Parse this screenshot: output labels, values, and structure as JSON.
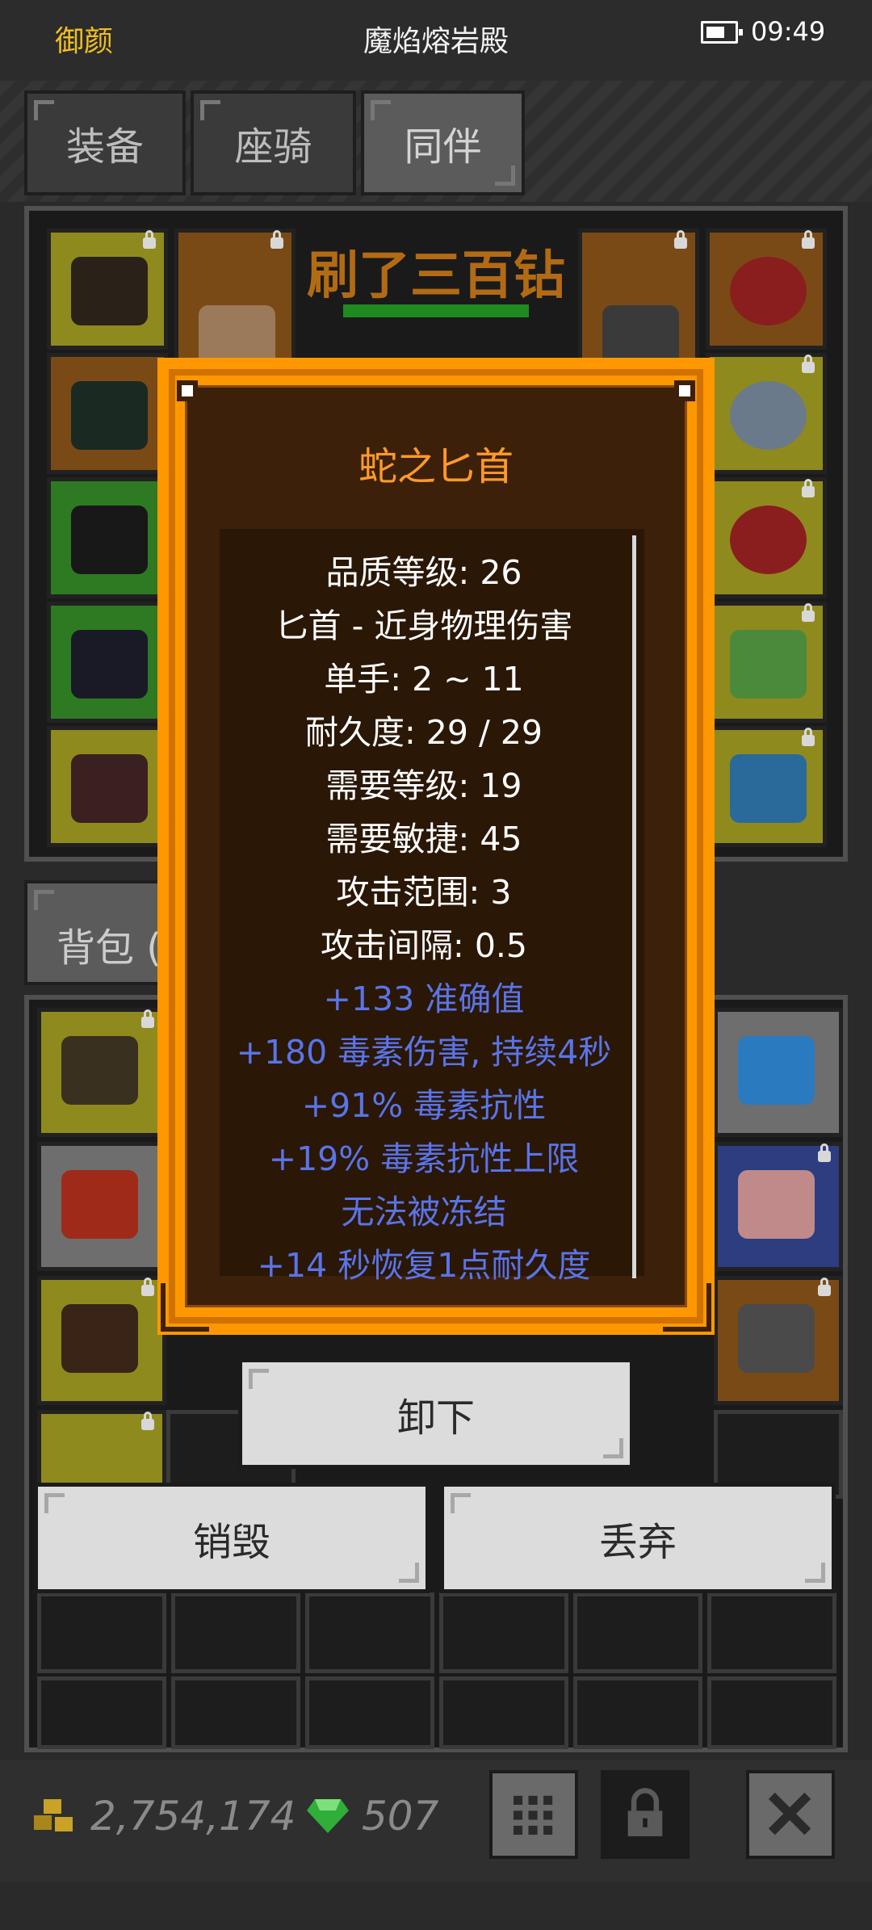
{
  "status": {
    "player": "御颜",
    "location": "魔焰熔岩殿",
    "time": "09:49"
  },
  "tabs": [
    {
      "label": "装备"
    },
    {
      "label": "座骑"
    },
    {
      "label": "同伴"
    }
  ],
  "equip": {
    "boss_name": "刷了三百钻"
  },
  "bag": {
    "tab_label": "背包 ("
  },
  "tooltip": {
    "title": "蛇之匕首",
    "stats": [
      "品质等级: 26",
      "匕首 - 近身物理伤害",
      "单手: 2 ~ 11",
      "耐久度: 29 / 29",
      "需要等级: 19",
      "需要敏捷: 45",
      "攻击范围: 3",
      "攻击间隔: 0.5"
    ],
    "affixes": [
      "+133 准确值",
      "+180 毒素伤害, 持续4秒",
      "+91% 毒素抗性",
      "+19% 毒素抗性上限",
      "无法被冻结",
      "+14 秒恢复1点耐久度"
    ]
  },
  "actions": {
    "unequip": "卸下",
    "destroy": "销毁",
    "discard": "丢弃"
  },
  "currency": {
    "gold": "2,754,174",
    "gems": "507"
  },
  "icons": {
    "gold": "gold-coins-icon",
    "gem": "green-gem-icon",
    "grid": "grid-icon",
    "lock": "lock-icon",
    "close": "close-icon"
  },
  "colors": {
    "title": "#ff9a2a",
    "affix": "#5a74e8",
    "frame": "#ff9800"
  }
}
